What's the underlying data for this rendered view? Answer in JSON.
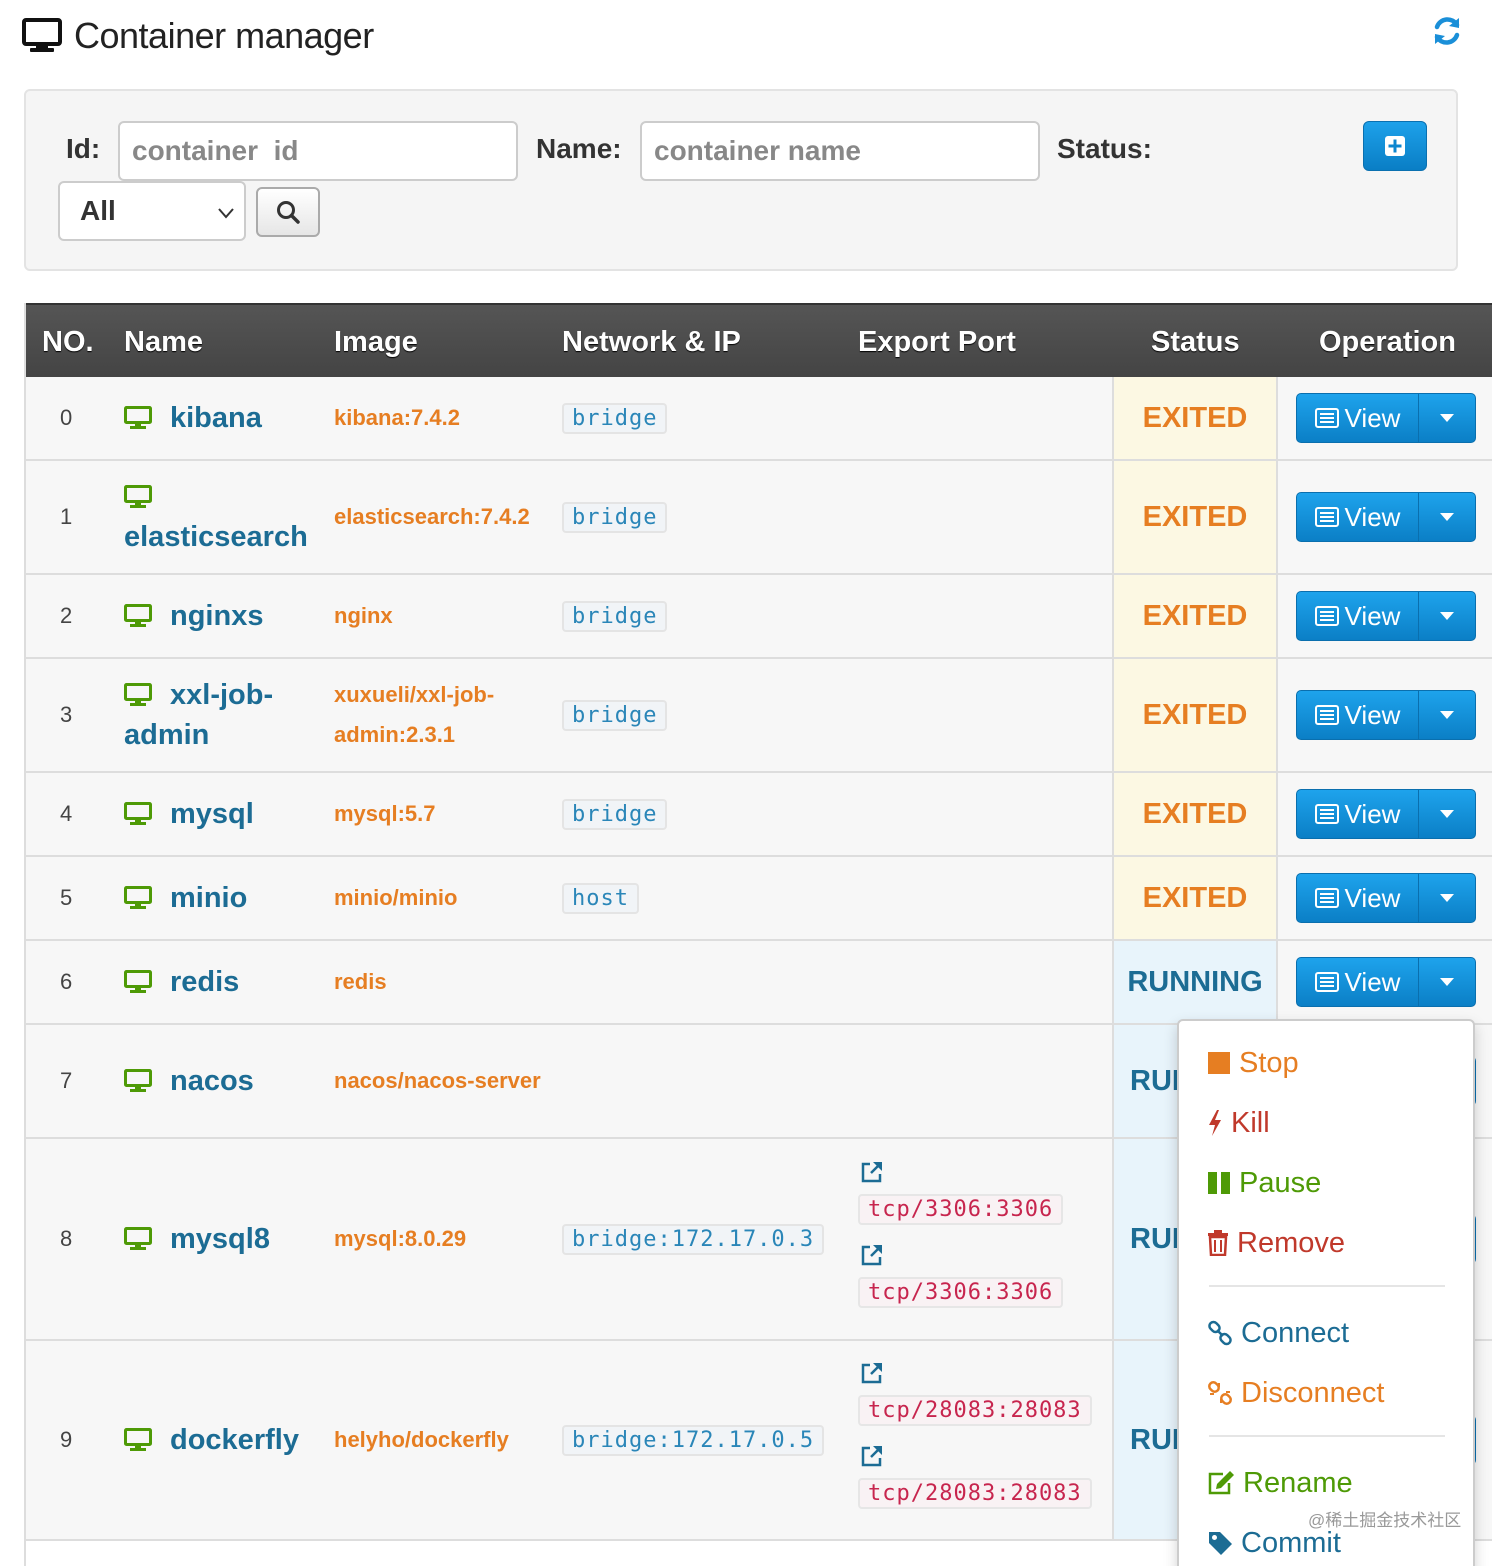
{
  "header": {
    "title": "Container manager",
    "icon": "desktop-icon",
    "refresh_icon": "refresh-icon"
  },
  "filter": {
    "id_label": "Id:",
    "id_placeholder": "container  id",
    "name_label": "Name:",
    "name_placeholder": "container name",
    "status_label": "Status:",
    "status_selected": "All",
    "search_icon": "search-icon",
    "add_icon": "plus-square-icon"
  },
  "table": {
    "headers": [
      "NO.",
      "Name",
      "Image",
      "Network & IP",
      "Export Port",
      "Status",
      "Operation"
    ],
    "view_label": "View",
    "rows": [
      {
        "no": "0",
        "name": "kibana",
        "image": "kibana:7.4.2",
        "network": "bridge",
        "ports": [],
        "status": "EXITED"
      },
      {
        "no": "1",
        "name": "elasticsearch",
        "image": "elasticsearch:7.4.2",
        "network": "bridge",
        "ports": [],
        "status": "EXITED"
      },
      {
        "no": "2",
        "name": "nginxs",
        "image": "nginx",
        "network": "bridge",
        "ports": [],
        "status": "EXITED"
      },
      {
        "no": "3",
        "name": "xxl-job-admin",
        "image": "xuxueli/xxl-job-admin:2.3.1",
        "network": "bridge",
        "ports": [],
        "status": "EXITED"
      },
      {
        "no": "4",
        "name": "mysql",
        "image": "mysql:5.7",
        "network": "bridge",
        "ports": [],
        "status": "EXITED"
      },
      {
        "no": "5",
        "name": "minio",
        "image": "minio/minio",
        "network": "host",
        "ports": [],
        "status": "EXITED"
      },
      {
        "no": "6",
        "name": "redis",
        "image": "redis",
        "network": "",
        "ports": [],
        "status": "RUNNING"
      },
      {
        "no": "7",
        "name": "nacos",
        "image": "nacos/nacos-server",
        "network": "",
        "ports": [],
        "status": "RUNI"
      },
      {
        "no": "8",
        "name": "mysql8",
        "image": "mysql:8.0.29",
        "network": "bridge:172.17.0.3",
        "ports": [
          "tcp/3306:3306",
          "tcp/3306:3306"
        ],
        "status": "RUNI"
      },
      {
        "no": "9",
        "name": "dockerfly",
        "image": "helyho/dockerfly",
        "network": "bridge:172.17.0.5",
        "ports": [
          "tcp/28083:28083",
          "tcp/28083:28083"
        ],
        "status": "RUNI"
      }
    ]
  },
  "dropdown": {
    "items": [
      {
        "label": "Stop",
        "icon": "stop-icon",
        "color": "#e67e22"
      },
      {
        "label": "Kill",
        "icon": "bolt-icon",
        "color": "#c0392b"
      },
      {
        "label": "Pause",
        "icon": "pause-icon",
        "color": "#4e9a06"
      },
      {
        "label": "Remove",
        "icon": "trash-icon",
        "color": "#c0392b"
      },
      {
        "label": "Connect",
        "icon": "link-icon",
        "color": "#1c6c94"
      },
      {
        "label": "Disconnect",
        "icon": "unlink-icon",
        "color": "#e67e22"
      },
      {
        "label": "Rename",
        "icon": "edit-icon",
        "color": "#4e9a06"
      },
      {
        "label": "Commit",
        "icon": "tag-icon",
        "color": "#1c6c94"
      }
    ]
  },
  "watermark": "@稀土掘金技术社区",
  "colors": {
    "accent": "#1a8fd8",
    "name": "#1c6c94",
    "image": "#e67e22",
    "exited": "#e67e22",
    "running": "#1c6c94"
  }
}
